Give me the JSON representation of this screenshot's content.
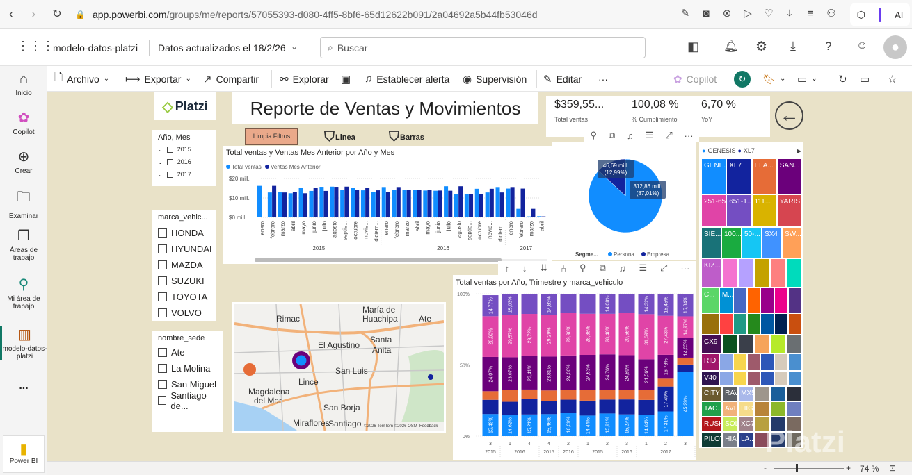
{
  "browser": {
    "url_host": "app.powerbi.com",
    "url_path": "/groups/me/reports/57055393-d080-4ff5-8bf6-65d12622b091/2a04692a5b44fb53046d",
    "ai_label": "AI"
  },
  "header": {
    "report_name": "modelo-datos-platzi",
    "updated": "Datos actualizados el 18/2/26",
    "search_placeholder": "Buscar"
  },
  "leftnav": [
    {
      "label": "Inicio",
      "icon": "home-icon"
    },
    {
      "label": "Copilot",
      "icon": "copilot-icon"
    },
    {
      "label": "Crear",
      "icon": "plus-circle-icon"
    },
    {
      "label": "Examinar",
      "icon": "folder-icon"
    },
    {
      "label": "Áreas de trabajo",
      "icon": "workspaces-icon"
    },
    {
      "label": "Mi área de trabajo",
      "icon": "person-icon"
    },
    {
      "label": "modelo-datos-platzi",
      "icon": "report-icon"
    },
    {
      "label": "...",
      "icon": "more-icon"
    },
    {
      "label": "Power BI",
      "icon": "powerbi-icon"
    }
  ],
  "toolbar": {
    "archivo": "Archivo",
    "exportar": "Exportar",
    "compartir": "Compartir",
    "explorar": "Explorar",
    "alerta": "Establecer alerta",
    "supervision": "Supervisión",
    "editar": "Editar",
    "more": "···",
    "copilot": "Copilot"
  },
  "report": {
    "logo": "Platzi",
    "title": "Reporte de Ventas y Movimientos",
    "clear_filters": "Limpia Filtros",
    "bookmark_line": "Linea",
    "bookmark_bars": "Barras",
    "kpis": [
      {
        "value": "$359,55...",
        "label": "Total ventas"
      },
      {
        "value": "100,08 %",
        "label": "% Cumplimiento"
      },
      {
        "value": "6,70 %",
        "label": "YoY"
      }
    ],
    "slicer_year": {
      "title": "Año, Mes",
      "items": [
        "2015",
        "2016",
        "2017"
      ]
    },
    "slicer_brand": {
      "title": "marca_vehic...",
      "items": [
        "HONDA",
        "HYUNDAI",
        "MAZDA",
        "SUZUKI",
        "TOYOTA",
        "VOLVO"
      ]
    },
    "slicer_site": {
      "title": "nombre_sede",
      "items": [
        "Ate",
        "La Molina",
        "San Miguel",
        "Santiago de..."
      ]
    },
    "map": {
      "labels": [
        "Rimac",
        "María de",
        "Huachipa",
        "Ate",
        "El Agustino",
        "Santa",
        "Anita",
        "San Luis",
        "Lince",
        "Magdalena",
        "del Mar",
        "San Borja",
        "Miraflores",
        "Santiago"
      ],
      "attribution": "©2026 TomTom ©2026 OSM",
      "feedback": "Feedback"
    },
    "watermark": "Platzi"
  },
  "status": {
    "zoom": "74 %",
    "minus": "-",
    "plus": "+"
  },
  "colors": {
    "canvas": "#e9e2c8",
    "blue": "#118dff",
    "navy": "#12239e",
    "orange": "#e66c37",
    "purple": "#6b007b",
    "pink": "#e044a7",
    "violet": "#744ec2"
  },
  "chart_data": [
    {
      "type": "bar",
      "title": "Total ventas y Ventas Mes Anterior por Año y Mes",
      "legend": [
        "Total ventas",
        "Ventas Mes Anterior"
      ],
      "yticks": [
        "$0 mill.",
        "$10 mill.",
        "$20 mill."
      ],
      "ylim": [
        0,
        20
      ],
      "unit": "millions",
      "years": [
        {
          "label": "2015",
          "count": 12
        },
        {
          "label": "2016",
          "count": 12
        },
        {
          "label": "2017",
          "count": 4
        }
      ],
      "categories": [
        "enero",
        "febrero",
        "marzo",
        "abril",
        "mayo",
        "junio",
        "julio",
        "agosto",
        "septie...",
        "octubre",
        "novie...",
        "diciem...",
        "enero",
        "febrero",
        "marzo",
        "abril",
        "mayo",
        "junio",
        "julio",
        "agosto",
        "septie...",
        "octubre",
        "novie...",
        "diciem...",
        "enero",
        "febrero",
        "marzo",
        "abril"
      ],
      "series": [
        {
          "name": "Total ventas",
          "values": [
            16.2,
            12.8,
            12.9,
            12.4,
            15.2,
            13.6,
            15.7,
            15.8,
            14.1,
            15.3,
            13.9,
            13.2,
            15.6,
            14.2,
            14.1,
            14.1,
            13.8,
            13.7,
            16.0,
            11.9,
            11.9,
            14.7,
            12.8,
            15.6,
            14.8,
            4.4,
            0.5,
            0.6
          ]
        },
        {
          "name": "Ventas Mes Anterior",
          "values": [
            0,
            16.2,
            12.8,
            12.9,
            12.4,
            15.2,
            13.6,
            15.7,
            15.8,
            14.1,
            15.3,
            13.9,
            13.2,
            15.6,
            14.2,
            14.1,
            14.1,
            13.8,
            13.7,
            16.0,
            11.9,
            11.9,
            14.7,
            12.8,
            15.6,
            14.8,
            4.4,
            0.5
          ]
        }
      ]
    },
    {
      "type": "pie",
      "legend_title": "Segme...",
      "slices": [
        {
          "name": "Persona",
          "value": 312.86,
          "percent": 87.01,
          "label": "312,86 mill.",
          "pct_label": "(87,01%)"
        },
        {
          "name": "Empresa",
          "value": 46.69,
          "percent": 12.99,
          "label": "46,69 mill.",
          "pct_label": "(12,99%)"
        }
      ]
    },
    {
      "type": "bar",
      "stacked": "100%",
      "title": "Total ventas por Año, Trimestre y marca_vehiculo",
      "yticks": [
        "0%",
        "50%",
        "100%"
      ],
      "quarters": [
        "3",
        "1",
        "4",
        "4",
        "2",
        "1",
        "2",
        "3",
        "1",
        "2",
        "3"
      ],
      "year_groups": [
        {
          "label": "2015",
          "count": 1
        },
        {
          "label": "2016",
          "count": 2
        },
        {
          "label": "2015",
          "count": 1
        },
        {
          "label": "2016",
          "count": 1
        },
        {
          "label": "2015",
          "count": 2
        },
        {
          "label": "2016",
          "count": 1
        },
        {
          "label": "2017",
          "count": 3
        }
      ],
      "segments": [
        "blue",
        "navy",
        "orange",
        "purple",
        "pink",
        "violet"
      ],
      "columns": [
        {
          "values": [
            15.49,
            10,
            6.07,
            24.07,
            28.6,
            14.77
          ],
          "labels": [
            "15,49%",
            "",
            "",
            "24,07%",
            "28,60%",
            "14,77%"
          ]
        },
        {
          "values": [
            14.62,
            9.5,
            8.21,
            23.07,
            29.57,
            15.03
          ],
          "labels": [
            "14,62%",
            "",
            "",
            "23,07%",
            "29,57%",
            "15,03%"
          ]
        },
        {
          "values": [
            15.21,
            11,
            6.5,
            23.41,
            29.72,
            14.16
          ],
          "labels": [
            "15,21%",
            "",
            "",
            "23,41%",
            "29,72%",
            ""
          ]
        },
        {
          "values": [
            15.46,
            9,
            7.61,
            23.81,
            29.29,
            14.83
          ],
          "labels": [
            "15,46%",
            "",
            "",
            "23,81%",
            "29,29%",
            "14,83%"
          ]
        },
        {
          "values": [
            16.09,
            9.5,
            7,
            24.06,
            29.96,
            13.39
          ],
          "labels": [
            "16,09%",
            "",
            "",
            "24,06%",
            "29,96%",
            ""
          ]
        },
        {
          "values": [
            14.44,
            10.5,
            7.5,
            24.63,
            28.88,
            14.05
          ],
          "labels": [
            "14,44%",
            "",
            "",
            "24,63%",
            "28,88%",
            ""
          ]
        },
        {
          "values": [
            15.91,
            9.77,
            7,
            24.76,
            28.48,
            14.08
          ],
          "labels": [
            "15,91%",
            "",
            "",
            "24,76%",
            "28,48%",
            "14,08%"
          ]
        },
        {
          "values": [
            15.27,
            10.5,
            6.5,
            24.59,
            29.55,
            13.59
          ],
          "labels": [
            "15,27%",
            "",
            "",
            "24,59%",
            "29,55%",
            ""
          ]
        },
        {
          "values": [
            14.64,
            10.79,
            7,
            21.56,
            31.69,
            14.32
          ],
          "labels": [
            "14,64%",
            "",
            "",
            "21,56%",
            "31,69%",
            "14,32%"
          ]
        },
        {
          "values": [
            17.31,
            17.49,
            5.54,
            16.78,
            27.43,
            15.45
          ],
          "labels": [
            "17,31%",
            "17,49%",
            "",
            "16,78%",
            "27,43%",
            "15,45%"
          ]
        },
        {
          "values": [
            45.29,
            5,
            4.85,
            14.05,
            14.97,
            15.84
          ],
          "labels": [
            "45,29%",
            "",
            "",
            "14,05%",
            "14,97%",
            "15,84%"
          ]
        }
      ]
    },
    {
      "type": "treemap",
      "legend": [
        "GENESIS",
        "XL7"
      ],
      "rows": [
        {
          "weight": 3,
          "cells": [
            {
              "l": "GENE...",
              "c": "#118dff"
            },
            {
              "l": "XL7",
              "c": "#12239e"
            },
            {
              "l": "ELA...",
              "c": "#e66c37"
            },
            {
              "l": "SAN...",
              "c": "#6b007b"
            }
          ]
        },
        {
          "weight": 2.7,
          "cells": [
            {
              "l": "251-650",
              "c": "#e044a7"
            },
            {
              "l": "651-1...",
              "c": "#744ec2"
            },
            {
              "l": "111...",
              "c": "#d9b300"
            },
            {
              "l": "YARIS",
              "c": "#d64550"
            }
          ]
        },
        {
          "weight": 2.6,
          "cells": [
            {
              "l": "SIE...",
              "c": "#197278"
            },
            {
              "l": "100...",
              "c": "#1aab40"
            },
            {
              "l": "50-...",
              "c": "#15c6f4"
            },
            {
              "l": "SX4",
              "c": "#4092ff"
            },
            {
              "l": "SW...",
              "c": "#ffa058"
            }
          ]
        },
        {
          "weight": 2.4,
          "cells": [
            {
              "l": "KIZ...",
              "c": "#be5dc9"
            },
            {
              "l": "",
              "c": "#f472d0"
            },
            {
              "l": "",
              "c": "#b5a1ff"
            },
            {
              "l": "",
              "c": "#c4a200"
            },
            {
              "l": "",
              "c": "#fd8080"
            },
            {
              "l": "",
              "c": "#00dbbc"
            }
          ]
        },
        {
          "weight": 2.1,
          "cells": [
            {
              "l": "C...",
              "c": "#5bd667"
            },
            {
              "l": "M...",
              "c": "#0091d5"
            },
            {
              "l": "",
              "c": "#4668c5"
            },
            {
              "l": "",
              "c": "#ff6300"
            },
            {
              "l": "",
              "c": "#99008a"
            },
            {
              "l": "",
              "c": "#ec008c"
            },
            {
              "l": "",
              "c": "#533285"
            }
          ]
        },
        {
          "weight": 1.7,
          "cells": [
            {
              "l": "",
              "c": "#99700a"
            },
            {
              "l": "",
              "c": "#ff4141"
            },
            {
              "l": "",
              "c": "#1f9a85"
            },
            {
              "l": "",
              "c": "#25891c"
            },
            {
              "l": "",
              "c": "#0057a2"
            },
            {
              "l": "",
              "c": "#002050"
            },
            {
              "l": "",
              "c": "#c94f0f"
            }
          ]
        },
        {
          "weight": 1.5,
          "cells": [
            {
              "l": "CX9",
              "c": "#450f54"
            },
            {
              "l": "",
              "c": "#0b511f"
            },
            {
              "l": "",
              "c": "#3a3f4a"
            },
            {
              "l": "",
              "c": "#f6a45a"
            },
            {
              "l": "",
              "c": "#b6ea2a"
            },
            {
              "l": "",
              "c": "#6a6f72"
            }
          ]
        },
        {
          "weight": 1.4,
          "cells": [
            {
              "l": "RID ...",
              "c": "#a0156a"
            },
            {
              "l": "",
              "c": "#8aa7e6"
            },
            {
              "l": "",
              "c": "#f7d54e"
            },
            {
              "l": "",
              "c": "#9e5a6b"
            },
            {
              "l": "",
              "c": "#2d57b8"
            },
            {
              "l": "",
              "c": "#d6cbbb"
            },
            {
              "l": "",
              "c": "#4a8fcf"
            }
          ]
        },
        {
          "weight": 1.2,
          "cells": [
            {
              "l": "V40",
              "c": "#2f1450"
            },
            {
              "l": "",
              "c": "#8aa7e6"
            },
            {
              "l": "",
              "c": "#f7d54e"
            },
            {
              "l": "",
              "c": "#9e5a6b"
            },
            {
              "l": "",
              "c": "#2d57b8"
            },
            {
              "l": "",
              "c": "#d6cbbb"
            },
            {
              "l": "",
              "c": "#4a8fcf"
            }
          ]
        },
        {
          "weight": 1.2,
          "cells": [
            {
              "l": "CITY",
              "c": "#6b5a2e"
            },
            {
              "l": "RAV4",
              "c": "#5b5f66"
            },
            {
              "l": "MX5",
              "c": "#a9b8ea"
            },
            {
              "l": "",
              "c": "#9e968c"
            },
            {
              "l": "",
              "c": "#1b5f9a"
            },
            {
              "l": "",
              "c": "#2b2f3a"
            }
          ]
        },
        {
          "weight": 1.2,
          "cells": [
            {
              "l": "TAC...",
              "c": "#1fa04a"
            },
            {
              "l": "AVE...",
              "c": "#f1b27a"
            },
            {
              "l": "HIG...",
              "c": "#f6dc8a"
            },
            {
              "l": "",
              "c": "#b8843a"
            },
            {
              "l": "",
              "c": "#8cb82a"
            },
            {
              "l": "",
              "c": "#6f7fbf"
            }
          ]
        },
        {
          "weight": 1.2,
          "cells": [
            {
              "l": "RUSH",
              "c": "#b3161c"
            },
            {
              "l": "SOL...",
              "c": "#c8ec5a"
            },
            {
              "l": "XC70",
              "c": "#a0828a"
            },
            {
              "l": "",
              "c": "#b8a040"
            },
            {
              "l": "",
              "c": "#243a6a"
            },
            {
              "l": "",
              "c": "#7a6a60"
            }
          ]
        },
        {
          "weight": 1.2,
          "cells": [
            {
              "l": "PILOT",
              "c": "#0f3b34"
            },
            {
              "l": "HIA...",
              "c": "#7a7f88"
            },
            {
              "l": "LA...",
              "c": "#2a3f8a"
            },
            {
              "l": "",
              "c": "#8a4a5a"
            },
            {
              "l": "",
              "c": "#243a6a"
            },
            {
              "l": "",
              "c": "#706a60"
            }
          ]
        }
      ]
    }
  ]
}
